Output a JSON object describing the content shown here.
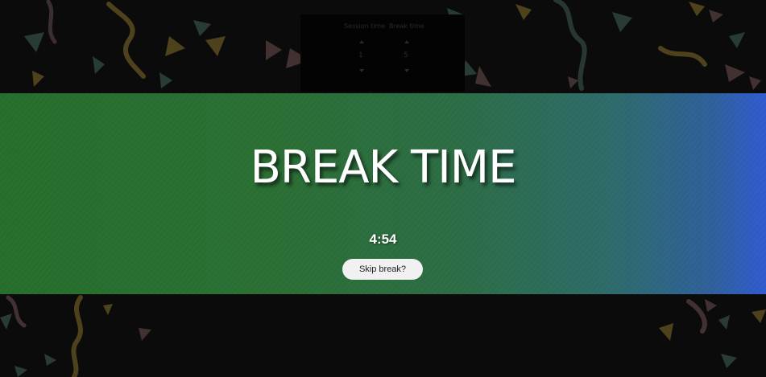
{
  "background_app": {
    "session_time_label": "Session time",
    "break_time_label": "Break time",
    "session_value": "1",
    "break_value": "5"
  },
  "break_screen": {
    "title": "BREAK TIME",
    "countdown": "4:54",
    "skip_label": "Skip break?"
  },
  "colors": {
    "banner_start": "#256d2c",
    "banner_end": "#2f5ad0",
    "page_background": "#101010",
    "button_background": "#f1f1f1"
  }
}
